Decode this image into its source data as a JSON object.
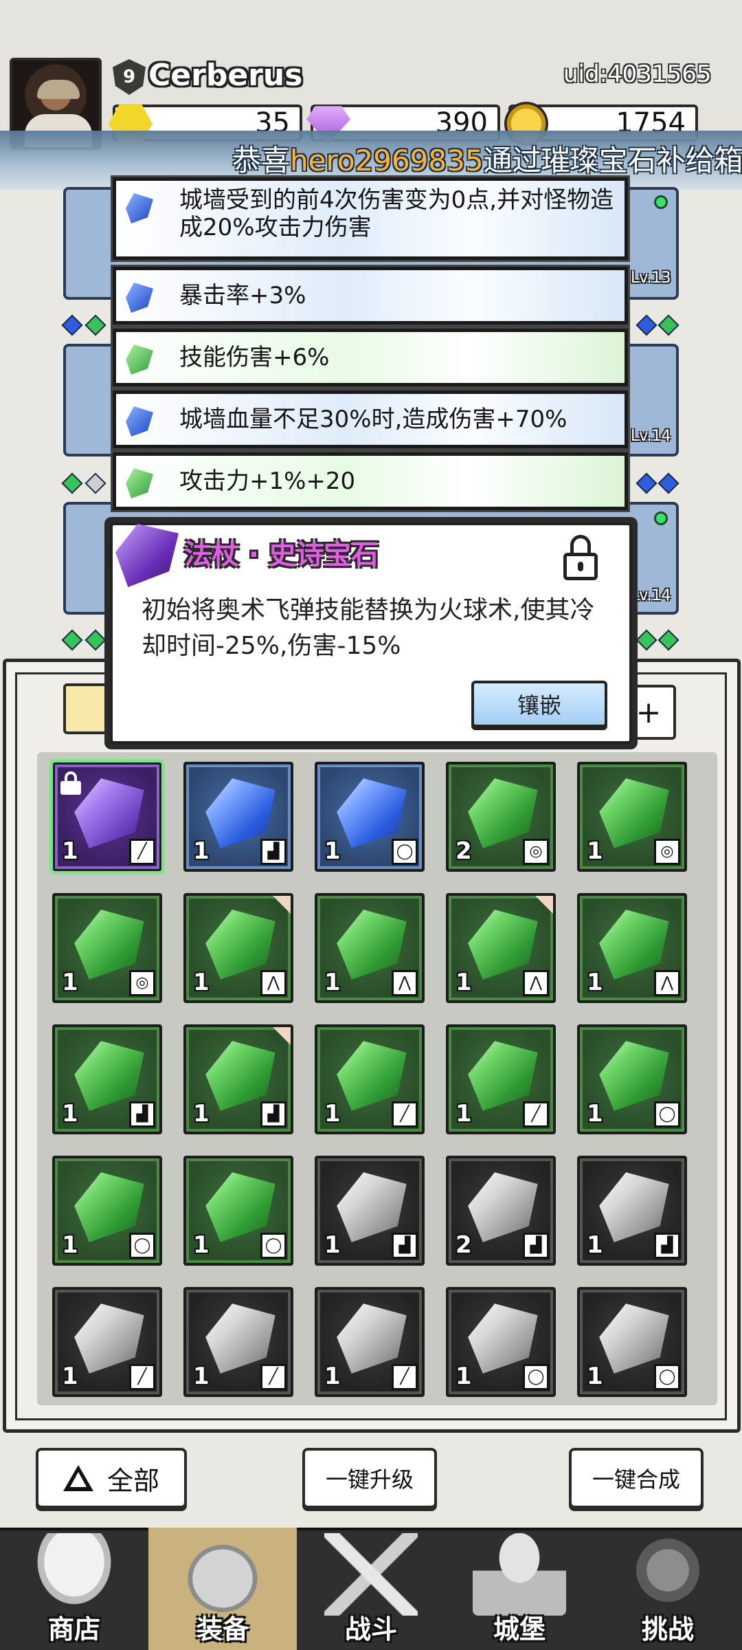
{
  "player": {
    "level": "9",
    "name": "Cerberus",
    "uid": "uid:4031565"
  },
  "currencies": {
    "gold": "35",
    "gems": "390",
    "coins": "1754"
  },
  "banner": {
    "prefix": "恭喜",
    "highlight": "hero2969835",
    "suffix": "通过璀璨宝石补给箱"
  },
  "equipment_levels": [
    "Lv.13",
    "Lv.14",
    "Lv.14"
  ],
  "effects": [
    {
      "gem": "blue",
      "text": "城墙受到的前4次伤害变为0点,并对怪物造成20%攻击力伤害"
    },
    {
      "gem": "blue",
      "text": "暴击率+3%"
    },
    {
      "gem": "green",
      "text": "技能伤害+6%"
    },
    {
      "gem": "blue",
      "text": "城墙血量不足30%时,造成伤害+70%"
    },
    {
      "gem": "green",
      "text": "攻击力+1%+20"
    }
  ],
  "tooltip": {
    "title": "法杖 · 史诗宝石",
    "description": "初始将奥术飞弹技能替换为火球术,使其冷却时间-25%,伤害-15%",
    "inlay_button": "镶嵌"
  },
  "panel": {
    "plus": "+"
  },
  "inventory": [
    {
      "color": "purple",
      "count": "1",
      "slot": "staff",
      "locked": true
    },
    {
      "color": "blue",
      "count": "1",
      "slot": "boots"
    },
    {
      "color": "blue",
      "count": "1",
      "slot": "ring"
    },
    {
      "color": "green",
      "count": "2",
      "slot": "amulet"
    },
    {
      "color": "green",
      "count": "1",
      "slot": "amulet"
    },
    {
      "color": "green",
      "count": "1",
      "slot": "amulet"
    },
    {
      "color": "green",
      "count": "1",
      "slot": "armor",
      "new": true
    },
    {
      "color": "green",
      "count": "1",
      "slot": "armor"
    },
    {
      "color": "green",
      "count": "1",
      "slot": "armor",
      "new": true
    },
    {
      "color": "green",
      "count": "1",
      "slot": "armor"
    },
    {
      "color": "green",
      "count": "1",
      "slot": "boots"
    },
    {
      "color": "green",
      "count": "1",
      "slot": "boots",
      "new": true
    },
    {
      "color": "green",
      "count": "1",
      "slot": "staff"
    },
    {
      "color": "green",
      "count": "1",
      "slot": "staff"
    },
    {
      "color": "green",
      "count": "1",
      "slot": "ring"
    },
    {
      "color": "green",
      "count": "1",
      "slot": "ring"
    },
    {
      "color": "green",
      "count": "1",
      "slot": "ring"
    },
    {
      "color": "gray",
      "count": "1",
      "slot": "boots"
    },
    {
      "color": "gray",
      "count": "2",
      "slot": "boots"
    },
    {
      "color": "gray",
      "count": "1",
      "slot": "boots"
    },
    {
      "color": "gray",
      "count": "1",
      "slot": "staff"
    },
    {
      "color": "gray",
      "count": "1",
      "slot": "staff"
    },
    {
      "color": "gray",
      "count": "1",
      "slot": "staff"
    },
    {
      "color": "gray",
      "count": "1",
      "slot": "ring"
    },
    {
      "color": "gray",
      "count": "1",
      "slot": "ring"
    }
  ],
  "actions": {
    "all": "全部",
    "upgrade": "一键升级",
    "merge": "一键合成"
  },
  "nav": [
    {
      "label": "商店",
      "icon": "shop-icon"
    },
    {
      "label": "装备",
      "icon": "backpack-icon",
      "active": true
    },
    {
      "label": "战斗",
      "icon": "swords-icon"
    },
    {
      "label": "城堡",
      "icon": "castle-icon"
    },
    {
      "label": "挑战",
      "icon": "challenge-icon"
    }
  ],
  "colors": {
    "epic": "#e05ee3",
    "banner_highlight": "#ffb23a",
    "active_tab": "#c9b27e"
  }
}
